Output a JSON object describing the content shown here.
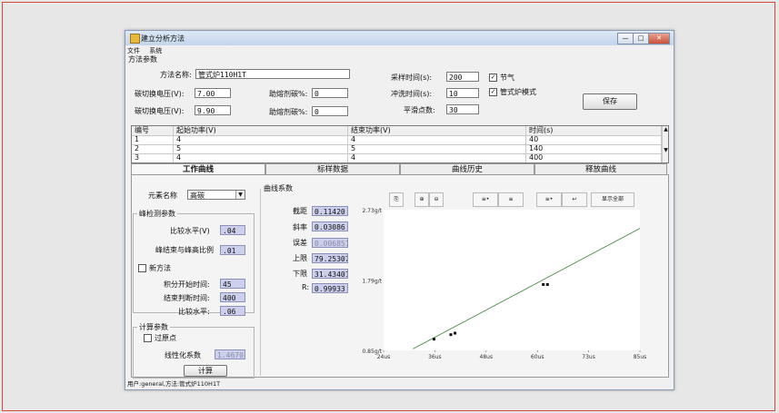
{
  "window": {
    "title": "建立分析方法",
    "min": "—",
    "max": "□",
    "close": "✕"
  },
  "menu": [
    "文件",
    "系统"
  ],
  "method_params": {
    "group_title": "方法参数",
    "method_name_label": "方法名称:",
    "method_name_value": "管式炉110H1T",
    "cutoff_high_label": "碳切换电压(V):",
    "cutoff_high_value": "7.00",
    "cutoff_low_label": "碳切换电压(V):",
    "cutoff_low_value": "9.90",
    "assist1_label": "助熔剂碳%:",
    "assist1_value": "0",
    "assist2_label": "助熔剂碳%:",
    "assist2_value": "0",
    "sample_time_label": "采样时间(s):",
    "sample_time_value": "200",
    "purge_time_label": "冲洗时间(s):",
    "purge_time_value": "10",
    "smooth_label": "平滑点数:",
    "smooth_value": "30",
    "check_gas": "节气",
    "check_furnace": "管式炉模式",
    "save_label": "保存"
  },
  "table": {
    "headers": [
      "编号",
      "起始功率(V)",
      "结束功率(V)",
      "时间(s)"
    ],
    "rows": [
      [
        "1",
        "4",
        "4",
        "40"
      ],
      [
        "2",
        "5",
        "5",
        "140"
      ],
      [
        "3",
        "4",
        "4",
        "400"
      ]
    ]
  },
  "tabs": [
    "工作曲线",
    "标样数据",
    "曲线历史",
    "释放曲线"
  ],
  "work_curve": {
    "element_label": "元素名称",
    "element_value": "高碳",
    "peak_group": "峰检测参数",
    "compare_level_label": "比较水平(V)",
    "compare_level_value": ".04",
    "peak_end_ratio_label": "峰结束与峰高比例",
    "peak_end_ratio_value": ".01",
    "new_method_label": "新方法",
    "integ_start_label": "积分开始时间:",
    "integ_start_value": "45",
    "end_judge_label": "结束判断时间:",
    "end_judge_value": "400",
    "compare_level2_label": "比较水平:",
    "compare_level2_value": ".06",
    "calc_group": "计算参数",
    "origin_label": "过原点",
    "linear_coef_label": "线性化系数",
    "linear_coef_value": "1.4670",
    "calc_button": "计算"
  },
  "curve_coef": {
    "group_title": "曲线系数",
    "intercept_label": "截距",
    "intercept_value": "0.11420",
    "slope_label": "斜率",
    "slope_value": "0.03086",
    "error_label": "误差",
    "error_value": "0.006851",
    "upper_label": "上限",
    "upper_value": "79.25307",
    "lower_label": "下限",
    "lower_value": "31.43401",
    "r_label": "R:",
    "r_value": "0.99933"
  },
  "chart_toolbar": [
    "⎘",
    "⊕",
    "⊖",
    "≡•",
    "≡",
    "≡•",
    "↩",
    "显示全部"
  ],
  "chart_data": {
    "type": "scatter",
    "x_ticks": [
      "24us",
      "36us",
      "48us",
      "60us",
      "73us",
      "85us"
    ],
    "y_ticks": [
      "0.85g/t",
      "1.79g/t",
      "2.73g/t"
    ],
    "x_range": [
      24,
      85
    ],
    "y_range": [
      0.85,
      2.73
    ],
    "points": [
      [
        36,
        1.0
      ],
      [
        40,
        1.06
      ],
      [
        41,
        1.08
      ],
      [
        62,
        1.73
      ],
      [
        63,
        1.73
      ]
    ],
    "fit_line": [
      [
        31,
        0.87
      ],
      [
        85,
        2.48
      ]
    ],
    "line_color": "#4c8a4a",
    "point_color": "#111111"
  },
  "status": "用户:general,方法:管式炉110H1T"
}
